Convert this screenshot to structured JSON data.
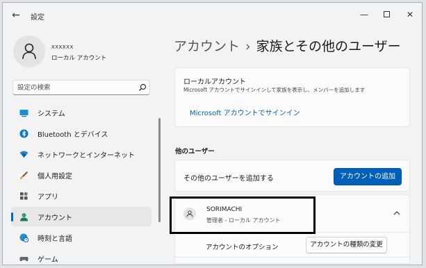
{
  "window": {
    "title": "設定",
    "back_glyph": "←",
    "min_glyph": "—",
    "close_glyph": "✕"
  },
  "user": {
    "name": "XXXXXX",
    "type": "ローカル アカウント"
  },
  "search": {
    "placeholder": "設定の検索",
    "value": ""
  },
  "sidebar": {
    "items": [
      {
        "label": "システム",
        "icon": "system-icon"
      },
      {
        "label": "Bluetooth とデバイス",
        "icon": "bluetooth-icon"
      },
      {
        "label": "ネットワークとインターネット",
        "icon": "network-icon"
      },
      {
        "label": "個人用設定",
        "icon": "brush-icon"
      },
      {
        "label": "アプリ",
        "icon": "apps-icon"
      },
      {
        "label": "アカウント",
        "icon": "account-icon",
        "selected": true
      },
      {
        "label": "時刻と言語",
        "icon": "globe-clock-icon"
      },
      {
        "label": "ゲーム",
        "icon": "gamepad-icon"
      }
    ]
  },
  "breadcrumb": {
    "parent": "アカウント",
    "separator": "›",
    "current": "家族とその他のユーザー"
  },
  "local_account": {
    "title": "ローカルアカウント",
    "description": "Microsoft アカウントでサインインして家族を表示し、メンバーを追加します",
    "link": "Microsoft アカウントでサインイン"
  },
  "other_users": {
    "section_title": "他のユーザー",
    "add_label": "その他のユーザーを追加する",
    "add_button": "アカウントの追加",
    "user": {
      "name": "SORIMACHI",
      "role": "管理者 - ローカル アカウント"
    },
    "options_label": "アカウントのオプション",
    "change_type_button": "アカウントの種類の変更"
  },
  "colors": {
    "accent": "#005fb8",
    "link": "#0063b1",
    "highlight": "#000000"
  }
}
